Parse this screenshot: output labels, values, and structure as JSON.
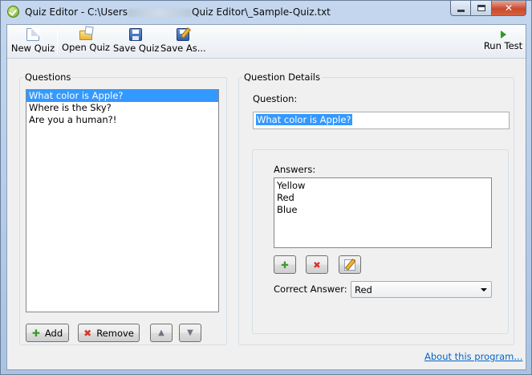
{
  "window": {
    "title_prefix": "Quiz Editor - C:\\Users",
    "title_suffix": "Quiz Editor\\_Sample-Quiz.txt"
  },
  "toolbar": {
    "new_quiz": "New Quiz",
    "open_quiz": "Open Quiz",
    "save_quiz": "Save Quiz",
    "save_as": "Save As...",
    "run_test": "Run Test"
  },
  "questions": {
    "group_title": "Questions",
    "items": [
      "What color is Apple?",
      "Where is the Sky?",
      "Are you a human?!"
    ],
    "selected_index": 0,
    "add_label": "Add",
    "remove_label": "Remove"
  },
  "details": {
    "group_title": "Question Details",
    "question_label": "Question:",
    "question_value": "What color is Apple?",
    "answers_label": "Answers:",
    "answers": [
      "Yellow",
      "Red",
      "Blue"
    ],
    "correct_answer_label": "Correct Answer:",
    "correct_answer_value": "Red"
  },
  "footer": {
    "about_link": "About this program..."
  },
  "colors": {
    "selection": "#3399ff",
    "link": "#0066cc",
    "accent_green": "#3a9a2b",
    "accent_red": "#d9342b"
  },
  "icons": {
    "title": "checkmark-icon",
    "new": "new-document-icon",
    "open": "open-folder-icon",
    "save": "floppy-disk-icon",
    "save_as": "floppy-pencil-icon",
    "run": "play-icon",
    "add": "plus-icon",
    "remove": "cross-icon",
    "move_up": "move-up-icon",
    "move_down": "move-down-icon",
    "edit": "edit-icon"
  }
}
